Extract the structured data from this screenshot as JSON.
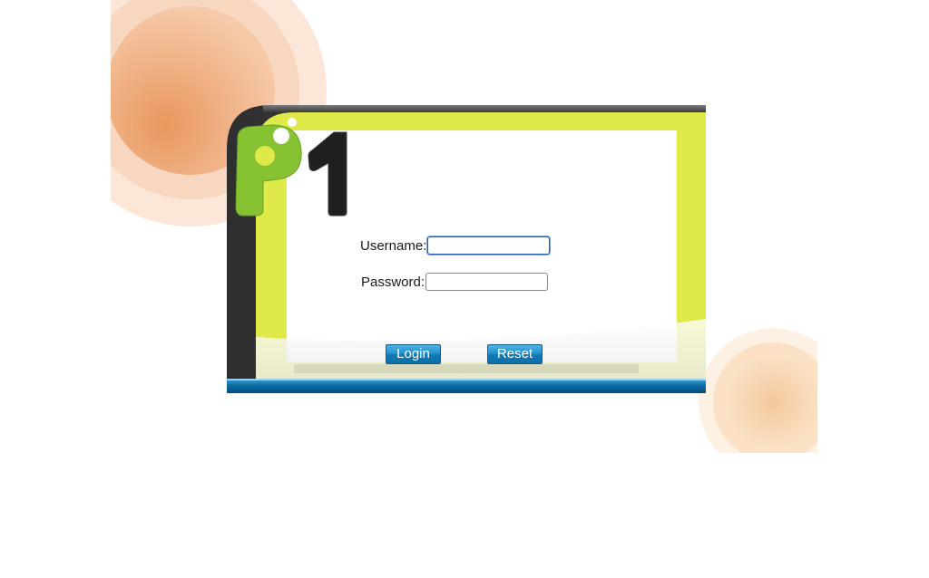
{
  "login_form": {
    "username_label": "Username:",
    "username_value": "",
    "password_label": "Password:",
    "password_value": "",
    "login_button": "Login",
    "reset_button": "Reset"
  },
  "logo": {
    "letter": "P",
    "number": "1"
  },
  "colors": {
    "frame_green": "#dfe94a",
    "frame_dark": "#3b3b3b",
    "bottom_bar_blue": "#0b6aa0",
    "logo_green": "#86c232",
    "button_blue": "#1f8ccb",
    "deco_orange": "#eea06d"
  }
}
